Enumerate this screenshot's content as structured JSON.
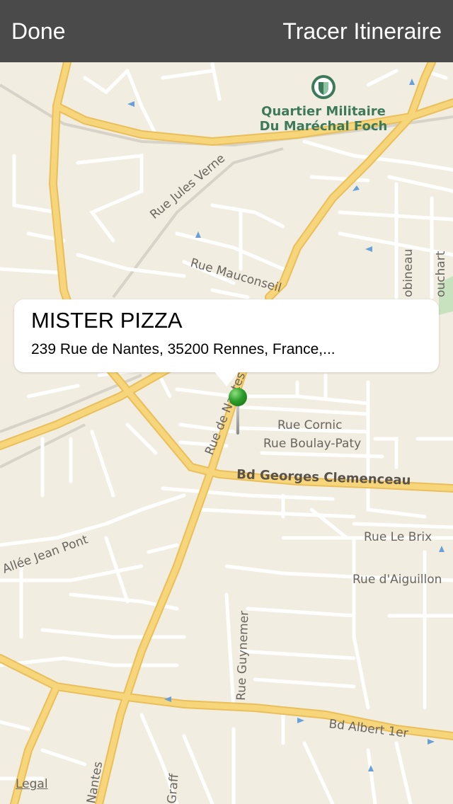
{
  "navbar": {
    "done_label": "Done",
    "route_label": "Tracer Itineraire"
  },
  "callout": {
    "title": "MISTER PIZZA",
    "subtitle": "239 Rue de Nantes, 35200 Rennes, France,..."
  },
  "map": {
    "poi": {
      "line1": "Quartier Militaire",
      "line2": "Du Maréchal Foch",
      "icon": "shield-icon"
    },
    "streets": {
      "jules_verne": "Rue Jules Verne",
      "mauconseil": "Rue Mauconseil",
      "robineau": "obineau",
      "bouchart": "ouchart",
      "nantes_top": "Rue de Nantes",
      "cornic": "Rue Cornic",
      "boulay_paty": "Rue Boulay-Paty",
      "georges_clemenceau": "Bd Georges Clemenceau",
      "allee_jean_pont": "Allée Jean Pont",
      "le_brix": "Rue Le Brix",
      "aiguillon": "Rue d'Aiguillon",
      "guynemer": "Rue Guynemer",
      "albert_1er": "Bd Albert 1er",
      "nantes_bottom": "Nantes",
      "graff": "Graff"
    },
    "legal_label": "Legal",
    "colors": {
      "land": "#f2ede1",
      "major_road": "#f7d57a",
      "minor_road": "#ffffff",
      "park": "#c8e2c0",
      "pin": "#2c9c2a",
      "navbar": "#4a4a4a"
    }
  }
}
